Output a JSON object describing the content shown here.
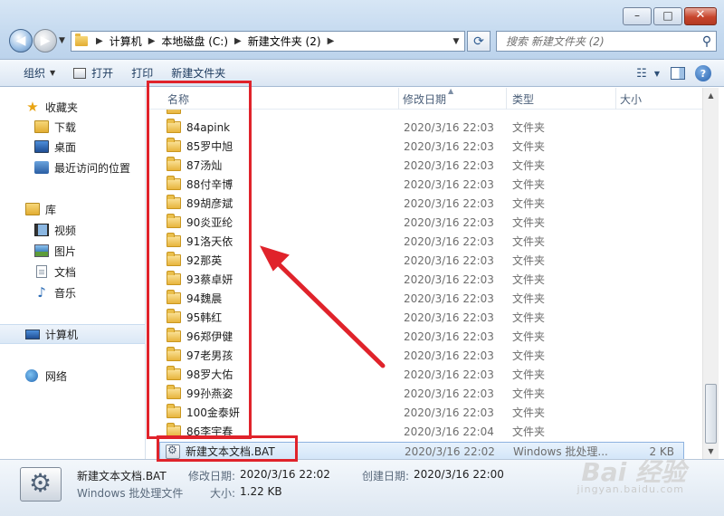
{
  "window": {
    "minimize_glyph": "–",
    "maximize_glyph": "□",
    "close_glyph": "✕"
  },
  "address": {
    "crumbs": [
      "计算机",
      "本地磁盘 (C:)",
      "新建文件夹 (2)"
    ],
    "search_placeholder": "搜索 新建文件夹 (2)"
  },
  "toolbar": {
    "organize": "组织",
    "open": "打开",
    "print": "打印",
    "new_folder": "新建文件夹"
  },
  "navpane": {
    "favorites": "收藏夹",
    "downloads": "下载",
    "desktop": "桌面",
    "recent": "最近访问的位置",
    "libraries": "库",
    "videos": "视频",
    "pictures": "图片",
    "documents": "文档",
    "music": "音乐",
    "computer": "计算机",
    "network": "网络"
  },
  "columns": {
    "name": "名称",
    "date": "修改日期",
    "type": "类型",
    "size": "大小"
  },
  "files": [
    {
      "name": "84apink",
      "date": "2020/3/16 22:03",
      "type": "文件夹",
      "size": ""
    },
    {
      "name": "85罗中旭",
      "date": "2020/3/16 22:03",
      "type": "文件夹",
      "size": ""
    },
    {
      "name": "87汤灿",
      "date": "2020/3/16 22:03",
      "type": "文件夹",
      "size": ""
    },
    {
      "name": "88付辛博",
      "date": "2020/3/16 22:03",
      "type": "文件夹",
      "size": ""
    },
    {
      "name": "89胡彦斌",
      "date": "2020/3/16 22:03",
      "type": "文件夹",
      "size": ""
    },
    {
      "name": "90炎亚纶",
      "date": "2020/3/16 22:03",
      "type": "文件夹",
      "size": ""
    },
    {
      "name": "91洛天依",
      "date": "2020/3/16 22:03",
      "type": "文件夹",
      "size": ""
    },
    {
      "name": "92那英",
      "date": "2020/3/16 22:03",
      "type": "文件夹",
      "size": ""
    },
    {
      "name": "93蔡卓妍",
      "date": "2020/3/16 22:03",
      "type": "文件夹",
      "size": ""
    },
    {
      "name": "94魏晨",
      "date": "2020/3/16 22:03",
      "type": "文件夹",
      "size": ""
    },
    {
      "name": "95韩红",
      "date": "2020/3/16 22:03",
      "type": "文件夹",
      "size": ""
    },
    {
      "name": "96郑伊健",
      "date": "2020/3/16 22:03",
      "type": "文件夹",
      "size": ""
    },
    {
      "name": "97老男孩",
      "date": "2020/3/16 22:03",
      "type": "文件夹",
      "size": ""
    },
    {
      "name": "98罗大佑",
      "date": "2020/3/16 22:03",
      "type": "文件夹",
      "size": ""
    },
    {
      "name": "99孙燕姿",
      "date": "2020/3/16 22:03",
      "type": "文件夹",
      "size": ""
    },
    {
      "name": "100金泰妍",
      "date": "2020/3/16 22:03",
      "type": "文件夹",
      "size": ""
    },
    {
      "name": "86李宇春",
      "date": "2020/3/16 22:04",
      "type": "文件夹",
      "size": ""
    },
    {
      "name": "新建文本文档.BAT",
      "date": "2020/3/16 22:02",
      "type": "Windows 批处理...",
      "size": "2 KB"
    }
  ],
  "details": {
    "name": "新建文本文档.BAT",
    "type": "Windows 批处理文件",
    "modified_label": "修改日期:",
    "modified_value": "2020/3/16 22:02",
    "created_label": "创建日期:",
    "created_value": "2020/3/16 22:00",
    "size_label": "大小:",
    "size_value": "1.22 KB"
  },
  "watermark": {
    "logo": "Bai 经验",
    "url": "jingyan.baidu.com"
  },
  "colors": {
    "annotation": "#e0232b",
    "selection": "#d2e5f8"
  }
}
